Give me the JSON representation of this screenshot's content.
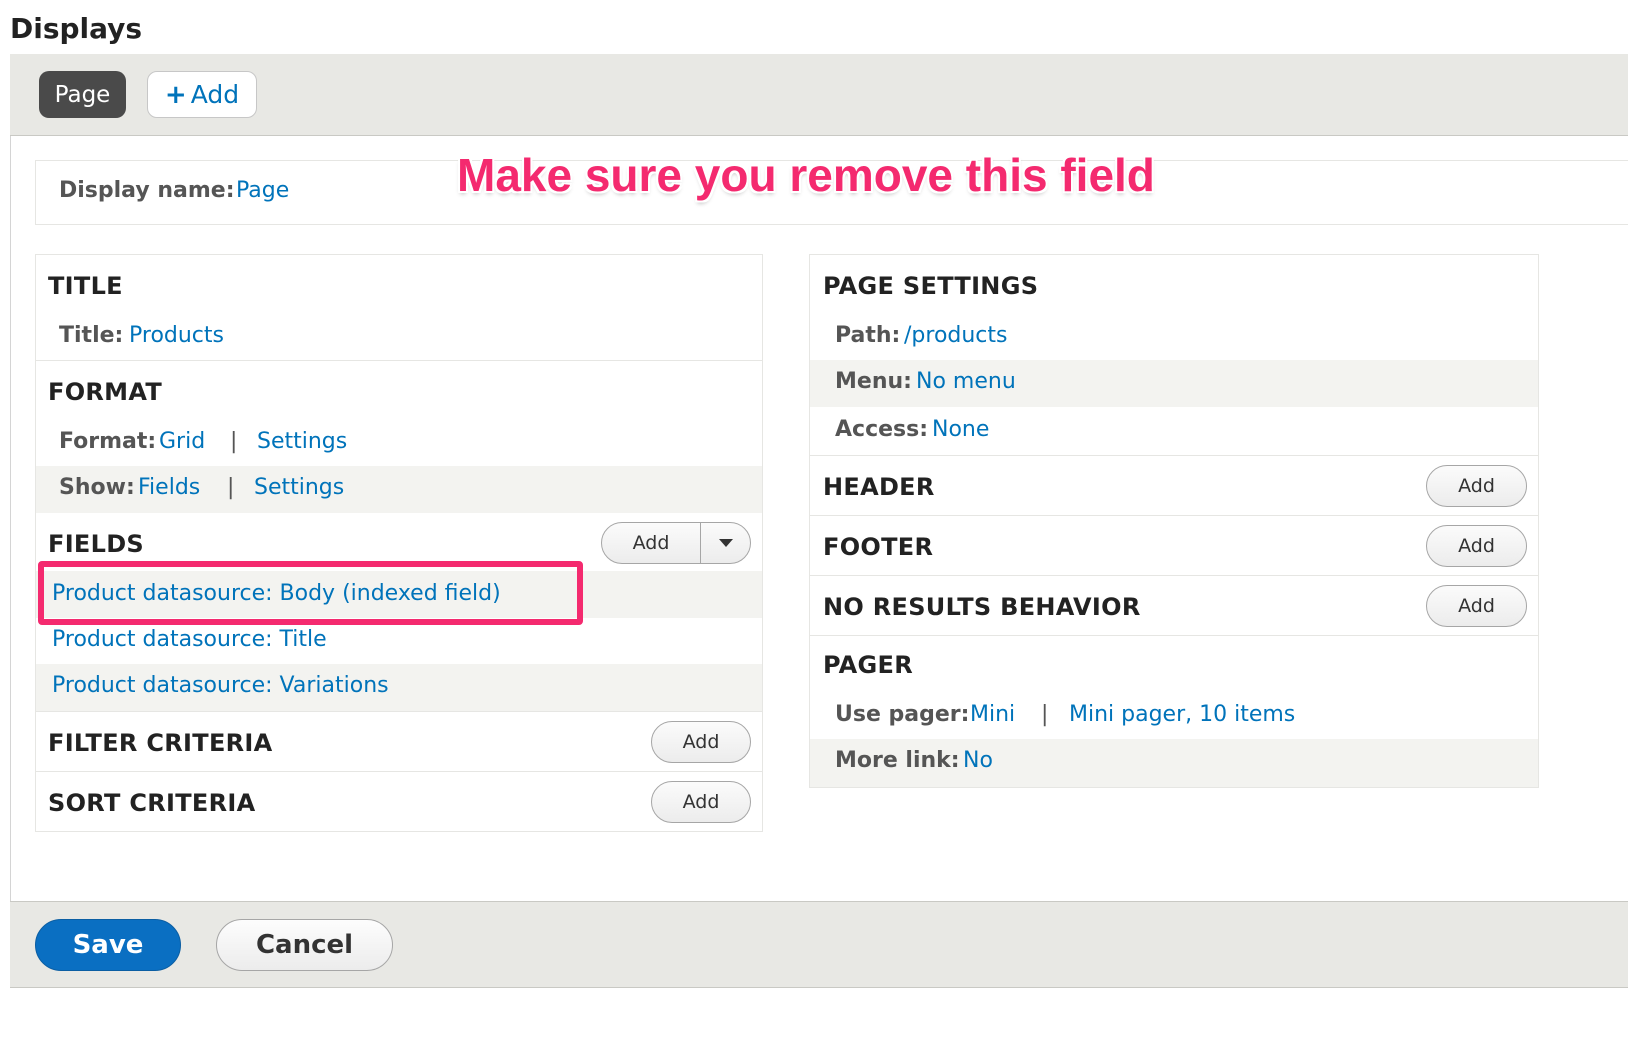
{
  "page": {
    "heading": "Displays"
  },
  "tabs": {
    "page_label": "Page",
    "add_icon": "+",
    "add_label": "Add"
  },
  "display_name": {
    "label": "Display name:",
    "value": "Page"
  },
  "annotation": {
    "text": "Make sure you remove this field",
    "color": "#f42a6f"
  },
  "left": {
    "title": {
      "heading": "TITLE",
      "label": "Title:",
      "value": "Products"
    },
    "format": {
      "heading": "FORMAT",
      "format_label": "Format:",
      "format_value": "Grid",
      "format_settings": "Settings",
      "show_label": "Show:",
      "show_value": "Fields",
      "show_settings": "Settings",
      "separator": "|"
    },
    "fields": {
      "heading": "FIELDS",
      "add_label": "Add",
      "items": [
        "Product datasource: Body (indexed field)",
        "Product datasource: Title",
        "Product datasource: Variations"
      ]
    },
    "filter": {
      "heading": "FILTER CRITERIA",
      "add_label": "Add"
    },
    "sort": {
      "heading": "SORT CRITERIA",
      "add_label": "Add"
    }
  },
  "right": {
    "page_settings": {
      "heading": "PAGE SETTINGS",
      "path_label": "Path:",
      "path_value": "/products",
      "menu_label": "Menu:",
      "menu_value": "No menu",
      "access_label": "Access:",
      "access_value": "None"
    },
    "header": {
      "heading": "HEADER",
      "add_label": "Add"
    },
    "footer": {
      "heading": "FOOTER",
      "add_label": "Add"
    },
    "no_results": {
      "heading": "NO RESULTS BEHAVIOR",
      "add_label": "Add"
    },
    "pager": {
      "heading": "PAGER",
      "use_label": "Use pager:",
      "use_value": "Mini",
      "use_settings": "Mini pager, 10 items",
      "more_label": "More link:",
      "more_value": "No",
      "separator": "|"
    }
  },
  "actions": {
    "save_label": "Save",
    "cancel_label": "Cancel"
  },
  "colors": {
    "link": "#0073ba",
    "primary_button": "#0a6fc2"
  }
}
